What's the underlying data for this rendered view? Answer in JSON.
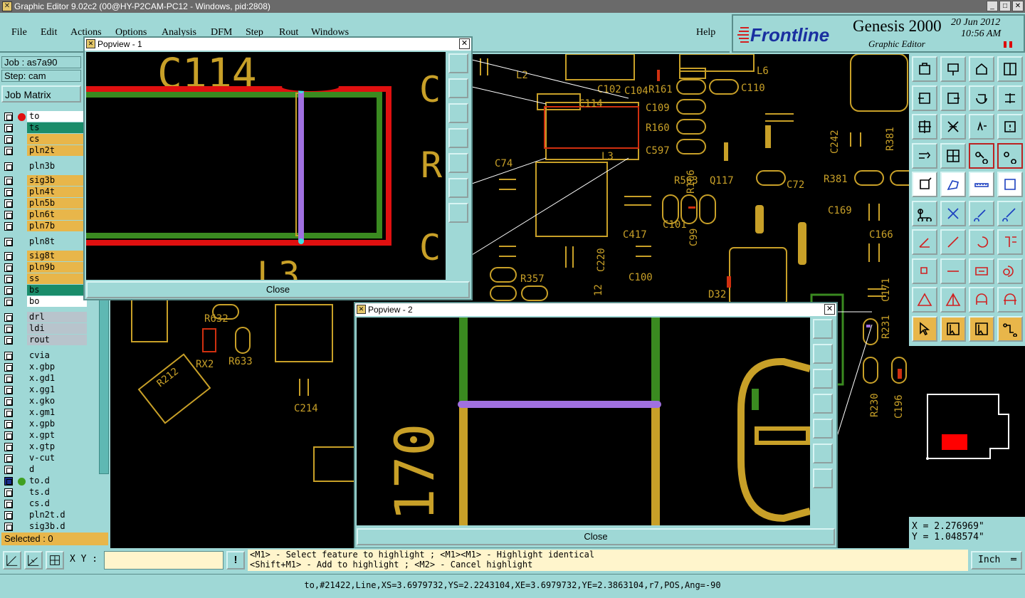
{
  "window": {
    "title": "Graphic Editor 9.02c2 (00@HY-P2CAM-PC12 - Windows, pid:2808)"
  },
  "menu": {
    "items": [
      "File",
      "Edit",
      "Actions",
      "Options",
      "Analysis",
      "DFM",
      "Step",
      "Rout",
      "Windows"
    ],
    "help": "Help"
  },
  "brand": {
    "logo": "Frontline",
    "product": "Genesis 2000",
    "subtitle": "Graphic Editor",
    "date": "20 Jun 2012",
    "time": "10:56 AM"
  },
  "job": {
    "job_label": "Job : as7a90",
    "step_label": "Step: cam",
    "matrix_button": "Job Matrix"
  },
  "layers": [
    {
      "name": "to",
      "color": "#ffffff",
      "dot": "#e01010"
    },
    {
      "name": "ts",
      "color": "#1a8c6a"
    },
    {
      "name": "cs",
      "color": "#e8b64a"
    },
    {
      "name": "pln2t",
      "color": "#e8b64a"
    },
    {
      "name": "pln3b",
      "color": "#9fd8d6"
    },
    {
      "name": "sig3b",
      "color": "#e8b64a"
    },
    {
      "name": "pln4t",
      "color": "#e8b64a"
    },
    {
      "name": "pln5b",
      "color": "#e8b64a"
    },
    {
      "name": "pln6t",
      "color": "#e8b64a"
    },
    {
      "name": "pln7b",
      "color": "#e8b64a"
    },
    {
      "name": "pln8t",
      "color": "#9fd8d6"
    },
    {
      "name": "sig8t",
      "color": "#e8b64a"
    },
    {
      "name": "pln9b",
      "color": "#e8b64a"
    },
    {
      "name": "ss",
      "color": "#e8b64a"
    },
    {
      "name": "bs",
      "color": "#1a8c6a"
    },
    {
      "name": "bo",
      "color": "#ffffff"
    },
    {
      "name": "drl",
      "color": "#b8c4cc"
    },
    {
      "name": "ldi",
      "color": "#b8c4cc"
    },
    {
      "name": "rout",
      "color": "#b8c4cc"
    },
    {
      "name": "cvia",
      "color": "#9fd8d6"
    },
    {
      "name": "x.gbp",
      "color": "#9fd8d6"
    },
    {
      "name": "x.gd1",
      "color": "#9fd8d6"
    },
    {
      "name": "x.gg1",
      "color": "#9fd8d6"
    },
    {
      "name": "x.gko",
      "color": "#9fd8d6"
    },
    {
      "name": "x.gm1",
      "color": "#9fd8d6"
    },
    {
      "name": "x.gpb",
      "color": "#9fd8d6"
    },
    {
      "name": "x.gpt",
      "color": "#9fd8d6"
    },
    {
      "name": "x.gtp",
      "color": "#9fd8d6"
    },
    {
      "name": "v-cut",
      "color": "#9fd8d6"
    },
    {
      "name": "d",
      "color": "#9fd8d6"
    },
    {
      "name": "to.d",
      "color": "#9fd8d6",
      "dot": "#3fa020"
    },
    {
      "name": "ts.d",
      "color": "#9fd8d6"
    },
    {
      "name": "cs.d",
      "color": "#9fd8d6"
    },
    {
      "name": "pln2t.d",
      "color": "#9fd8d6"
    },
    {
      "name": "sig3b.d",
      "color": "#9fd8d6"
    }
  ],
  "selected": "Selected : 0",
  "popview1": {
    "title": "Popview - 1",
    "close": "Close",
    "labels": [
      "C114",
      "L3"
    ]
  },
  "popview2": {
    "title": "Popview - 2",
    "close": "Close",
    "label": "170"
  },
  "coords": {
    "x": "X = 2.276969\"",
    "y": "Y = 1.048574\""
  },
  "bottom": {
    "xy_label": "X Y :",
    "xy_value": "",
    "help_line1": "<M1> - Select feature to highlight ; <M1><M1> - Highlight identical",
    "help_line2": "<Shift+M1> - Add to highlight ; <M2> - Cancel highlight",
    "unit": "Inch"
  },
  "status": "to,#21422,Line,XS=3.6979732,YS=2.2243104,XE=3.6979732,YE=2.3863104,r7,POS,Ang=-90",
  "canvas_labels": [
    "C102",
    "C104",
    "L2",
    "C114",
    "L3",
    "R161",
    "C110",
    "L6",
    "C109",
    "R160",
    "C597",
    "R563",
    "Q117",
    "C72",
    "R381",
    "C242",
    "C169",
    "C166",
    "C74",
    "C417",
    "C100",
    "C220",
    "R357",
    "C101",
    "C99",
    "D32",
    "R632",
    "R633",
    "RX2",
    "R212",
    "C214",
    "R231",
    "R230",
    "C196",
    "C171",
    "R106",
    "C223",
    "12",
    "L1"
  ]
}
